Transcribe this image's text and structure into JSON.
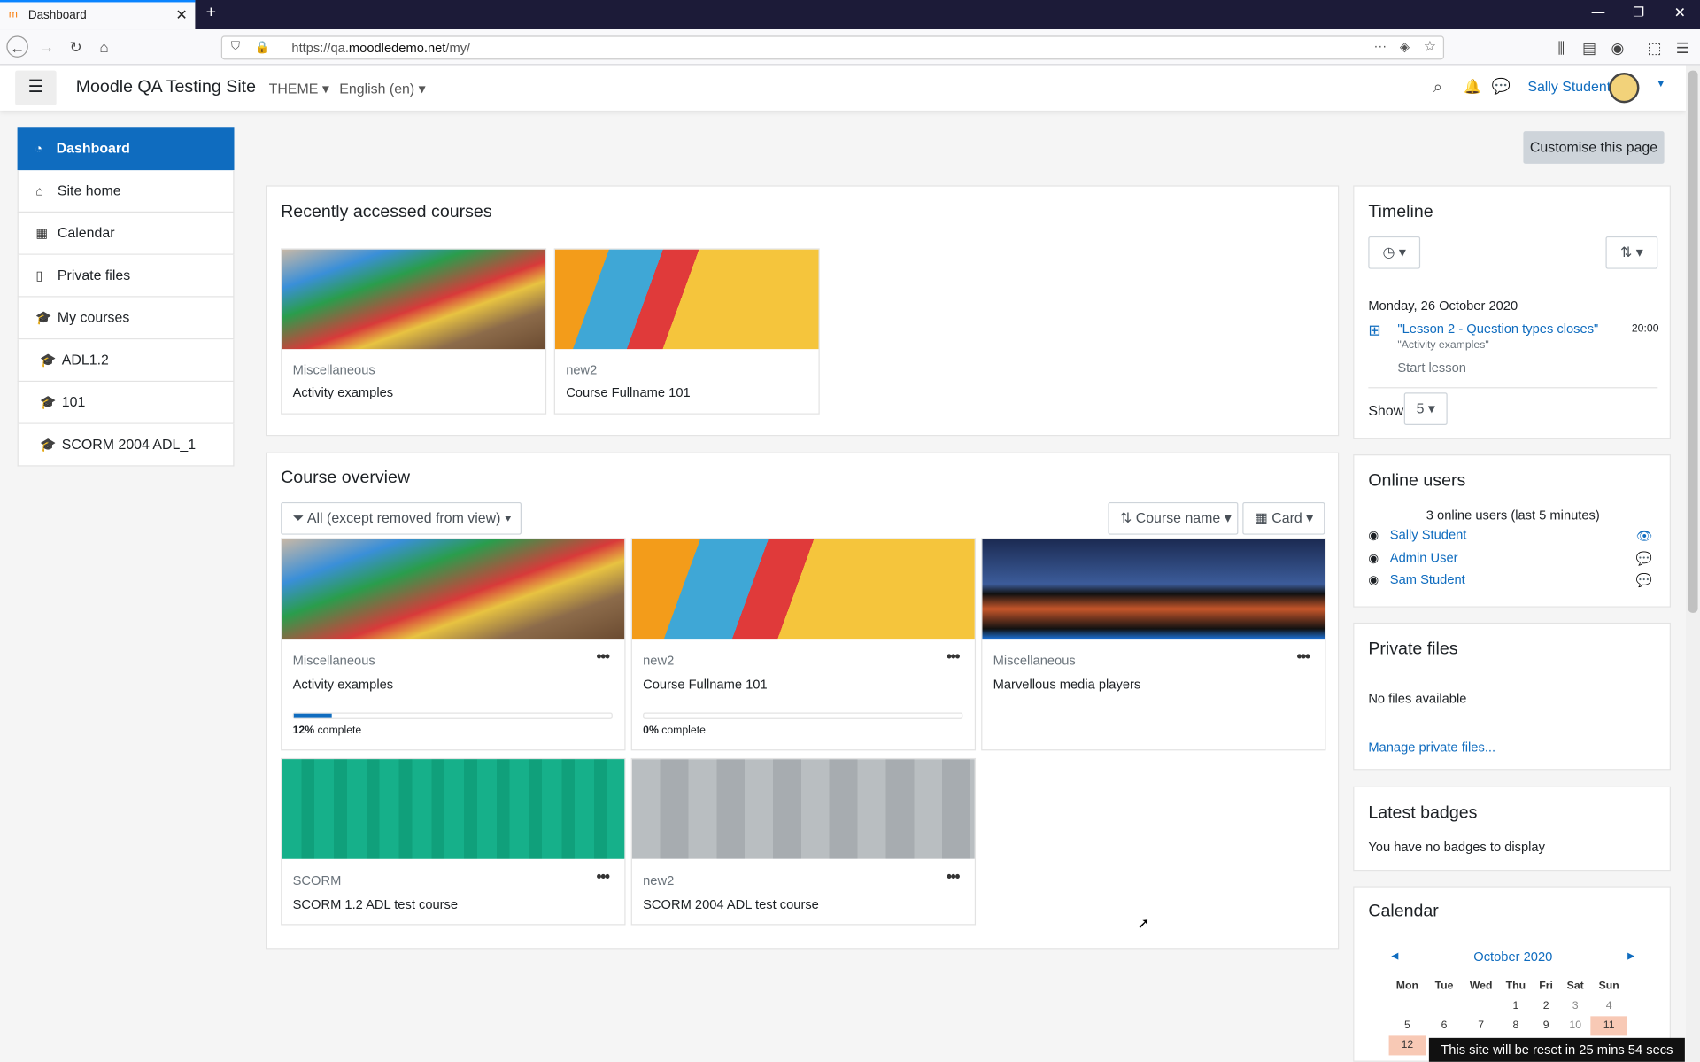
{
  "browser": {
    "tab_title": "Dashboard",
    "url_prefix": "https://qa.",
    "url_domain": "moodledemo.net",
    "url_path": "/my/"
  },
  "header": {
    "site_name": "Moodle QA Testing Site",
    "theme_label": "THEME",
    "language_label": "English (en)",
    "user_name": "Sally Student"
  },
  "sidebar": {
    "items": [
      {
        "label": "Dashboard"
      },
      {
        "label": "Site home"
      },
      {
        "label": "Calendar"
      },
      {
        "label": "Private files"
      },
      {
        "label": "My courses"
      },
      {
        "label": "ADL1.2"
      },
      {
        "label": "101"
      },
      {
        "label": "SCORM 2004 ADL_1"
      }
    ]
  },
  "customise_label": "Customise this page",
  "recent": {
    "title": "Recently accessed courses",
    "courses": [
      {
        "category": "Miscellaneous",
        "name": "Activity examples"
      },
      {
        "category": "new2",
        "name": "Course Fullname 101"
      }
    ]
  },
  "overview": {
    "title": "Course overview",
    "filter_label": "All (except removed from view)",
    "sort_label": "Course name",
    "view_label": "Card",
    "courses": [
      {
        "category": "Miscellaneous",
        "name": "Activity examples",
        "progress": 12,
        "progress_pct": "12%",
        "progress_text": " complete"
      },
      {
        "category": "new2",
        "name": "Course Fullname 101",
        "progress": 0,
        "progress_pct": "0%",
        "progress_text": " complete"
      },
      {
        "category": "Miscellaneous",
        "name": "Marvellous media players"
      },
      {
        "category": "SCORM",
        "name": "SCORM 1.2 ADL test course"
      },
      {
        "category": "new2",
        "name": "SCORM 2004 ADL test course"
      }
    ]
  },
  "timeline": {
    "title": "Timeline",
    "date": "Monday, 26 October 2020",
    "event_title": "\"Lesson 2 - Question types closes\"",
    "event_course": "\"Activity examples\"",
    "event_time": "20:00",
    "event_action": "Start lesson",
    "show_label": "Show",
    "show_value": "5"
  },
  "online": {
    "title": "Online users",
    "summary": "3 online users (last 5 minutes)",
    "users": [
      "Sally Student",
      "Admin User",
      "Sam Student"
    ]
  },
  "private_files": {
    "title": "Private files",
    "empty": "No files available",
    "manage": "Manage private files..."
  },
  "badges": {
    "title": "Latest badges",
    "empty": "You have no badges to display"
  },
  "calendar": {
    "title": "Calendar",
    "month": "October 2020",
    "prev": "◄",
    "next": "►",
    "days": [
      "Mon",
      "Tue",
      "Wed",
      "Thu",
      "Fri",
      "Sat",
      "Sun"
    ],
    "rows": [
      [
        "",
        "",
        "",
        "1",
        "2",
        "3",
        "4"
      ],
      [
        "5",
        "6",
        "7",
        "8",
        "9",
        "10",
        "11"
      ],
      [
        "12",
        "",
        "",
        "",
        "",
        "",
        ""
      ]
    ]
  },
  "reset_notice": "This site will be reset in 25 mins 54 secs",
  "colors": {
    "primary": "#0f6cbf",
    "today": "#f8c9b5"
  }
}
